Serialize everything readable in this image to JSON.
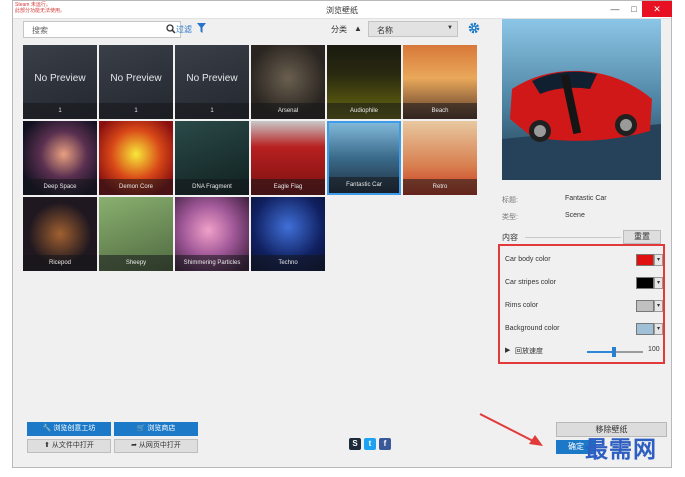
{
  "window": {
    "title": "浏览壁纸",
    "steam_warning_lines": [
      "Steam 未运行。",
      "此部分功能无法使用。"
    ],
    "controls": {
      "minimize": "—",
      "maximize": "□",
      "close": "✕"
    }
  },
  "toolbar": {
    "search_placeholder": "搜索",
    "filter_label": "过滤",
    "category_label": "分类",
    "sort_direction": "▲",
    "sort_value": "名称"
  },
  "wallpapers": [
    {
      "name": "",
      "count": "1",
      "no_preview": "No Preview",
      "bg": "linear-gradient(160deg,#3a3f48,#23272e)"
    },
    {
      "name": "",
      "count": "1",
      "no_preview": "No Preview",
      "bg": "linear-gradient(160deg,#3a3f48,#23272e)"
    },
    {
      "name": "",
      "count": "1",
      "no_preview": "No Preview",
      "bg": "linear-gradient(160deg,#3a3f48,#23272e)"
    },
    {
      "name": "Arsenal",
      "count": "",
      "no_preview": "",
      "bg": "radial-gradient(circle at 50% 45%,#6a5f50,#2a2520 70%)"
    },
    {
      "name": "Audiophile",
      "count": "",
      "no_preview": "",
      "bg": "linear-gradient(180deg,#1a1a10 0%,#2a2a10 40%,#6a6a10 100%)"
    },
    {
      "name": "Beach",
      "count": "",
      "no_preview": "",
      "bg": "linear-gradient(180deg,#d8783a 0%,#e9a85a 45%,#5a3a2a 100%)"
    },
    {
      "name": "Deep Space",
      "count": "",
      "no_preview": "",
      "bg": "radial-gradient(circle at 55% 45%,#e8a080,#5a3050 40%,#101020 80%)"
    },
    {
      "name": "Demon Core",
      "count": "",
      "no_preview": "",
      "bg": "radial-gradient(circle at 50% 45%,#f8e838,#d84818 45%,#8a1010 80%)"
    },
    {
      "name": "DNA Fragment",
      "count": "",
      "no_preview": "",
      "bg": "linear-gradient(160deg,#2a4a48,#102020)"
    },
    {
      "name": "Eagle Flag",
      "count": "",
      "no_preview": "",
      "bg": "linear-gradient(180deg,#c8c8c8 0%,#b82020 35%,#7a1010 100%)"
    },
    {
      "name": "Fantastic Car",
      "count": "",
      "no_preview": "",
      "bg": "linear-gradient(180deg,#80b8d8 0%,#3a6a8a 50%,#203040 100%)"
    },
    {
      "name": "Retro",
      "count": "",
      "no_preview": "",
      "bg": "linear-gradient(180deg,#e8c8a0 0%,#d88050 60%,#c83820 100%)"
    },
    {
      "name": "Ricepod",
      "count": "",
      "no_preview": "",
      "bg": "radial-gradient(circle at 50% 50%,#a06030,#201820 60%)"
    },
    {
      "name": "Sheepy",
      "count": "",
      "no_preview": "",
      "bg": "linear-gradient(160deg,#8ab070,#506a40)"
    },
    {
      "name": "Shimmering Particles",
      "count": "",
      "no_preview": "",
      "bg": "radial-gradient(circle at 45% 45%,#f0a0c8,#a05898 45%,#402040 90%)"
    },
    {
      "name": "Techno",
      "count": "",
      "no_preview": "",
      "bg": "radial-gradient(circle at 50% 40%,#4070d8,#102060 60%,#081030 100%)"
    }
  ],
  "selected_index": 10,
  "details": {
    "title_label": "标题:",
    "title_value": "Fantastic Car",
    "type_label": "类型:",
    "type_value": "Scene",
    "content_label": "内容",
    "reset_label": "重置"
  },
  "properties": {
    "rows": [
      {
        "label": "Car body color",
        "color": "#e01010"
      },
      {
        "label": "Car stripes color",
        "color": "#000000"
      },
      {
        "label": "Rims color",
        "color": "#c0c0c0"
      },
      {
        "label": "Background color",
        "color": "#a0c0d8"
      }
    ],
    "dropdown_glyph": "▾",
    "speed_label": "回放速度",
    "speed_arrow": "▶",
    "speed_value": "100",
    "speed_fraction": 0.48
  },
  "bottom_buttons": {
    "workshop": "浏览创意工坊",
    "store": "浏览商店",
    "open_file": "从文件中打开",
    "open_web": "从网页中打开",
    "dismiss": "移除壁纸",
    "confirm": "确定"
  },
  "social": {
    "steam": "S",
    "twitter": "t",
    "facebook": "f"
  },
  "watermark": "最需网",
  "colors": {
    "accent": "#1b79c8",
    "highlight_box": "#e23a3a",
    "selected_tile": "#3d9be9"
  }
}
